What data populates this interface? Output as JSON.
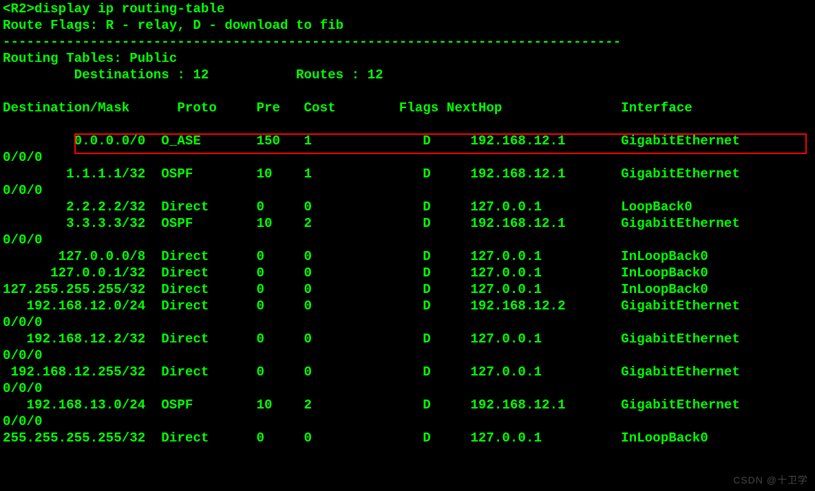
{
  "prompt_prefix": "<R2>",
  "command": "display ip routing-table",
  "flags_line": "Route Flags: R - relay, D - download to fib",
  "dashline": "------------------------------------------------------------------------------",
  "tables_line": "Routing Tables: Public",
  "destinations_label": "Destinations :",
  "destinations_value": "12",
  "routes_label": "Routes :",
  "routes_value": "12",
  "headers": {
    "dest": "Destination/Mask",
    "proto": "Proto",
    "pre": "Pre",
    "cost": "Cost",
    "flags": "Flags",
    "nexthop": "NextHop",
    "interface": "Interface"
  },
  "routes": [
    {
      "dest": "0.0.0.0/0",
      "proto": "O_ASE",
      "pre": "150",
      "cost": "1",
      "flags": "D",
      "nexthop": "192.168.12.1",
      "interface": "GigabitEthernet",
      "wrap": "0/0/0",
      "highlight": true
    },
    {
      "dest": "1.1.1.1/32",
      "proto": "OSPF",
      "pre": "10",
      "cost": "1",
      "flags": "D",
      "nexthop": "192.168.12.1",
      "interface": "GigabitEthernet",
      "wrap": "0/0/0"
    },
    {
      "dest": "2.2.2.2/32",
      "proto": "Direct",
      "pre": "0",
      "cost": "0",
      "flags": "D",
      "nexthop": "127.0.0.1",
      "interface": "LoopBack0"
    },
    {
      "dest": "3.3.3.3/32",
      "proto": "OSPF",
      "pre": "10",
      "cost": "2",
      "flags": "D",
      "nexthop": "192.168.12.1",
      "interface": "GigabitEthernet",
      "wrap": "0/0/0"
    },
    {
      "dest": "127.0.0.0/8",
      "proto": "Direct",
      "pre": "0",
      "cost": "0",
      "flags": "D",
      "nexthop": "127.0.0.1",
      "interface": "InLoopBack0"
    },
    {
      "dest": "127.0.0.1/32",
      "proto": "Direct",
      "pre": "0",
      "cost": "0",
      "flags": "D",
      "nexthop": "127.0.0.1",
      "interface": "InLoopBack0"
    },
    {
      "dest": "127.255.255.255/32",
      "proto": "Direct",
      "pre": "0",
      "cost": "0",
      "flags": "D",
      "nexthop": "127.0.0.1",
      "interface": "InLoopBack0"
    },
    {
      "dest": "192.168.12.0/24",
      "proto": "Direct",
      "pre": "0",
      "cost": "0",
      "flags": "D",
      "nexthop": "192.168.12.2",
      "interface": "GigabitEthernet",
      "wrap": "0/0/0"
    },
    {
      "dest": "192.168.12.2/32",
      "proto": "Direct",
      "pre": "0",
      "cost": "0",
      "flags": "D",
      "nexthop": "127.0.0.1",
      "interface": "GigabitEthernet",
      "wrap": "0/0/0"
    },
    {
      "dest": "192.168.12.255/32",
      "proto": "Direct",
      "pre": "0",
      "cost": "0",
      "flags": "D",
      "nexthop": "127.0.0.1",
      "interface": "GigabitEthernet",
      "wrap": "0/0/0"
    },
    {
      "dest": "192.168.13.0/24",
      "proto": "OSPF",
      "pre": "10",
      "cost": "2",
      "flags": "D",
      "nexthop": "192.168.12.1",
      "interface": "GigabitEthernet",
      "wrap": "0/0/0"
    },
    {
      "dest": "255.255.255.255/32",
      "proto": "Direct",
      "pre": "0",
      "cost": "0",
      "flags": "D",
      "nexthop": "127.0.0.1",
      "interface": "InLoopBack0"
    }
  ],
  "watermark": "CSDN @十卫学",
  "cols": {
    "dest_right": 18,
    "proto": 20,
    "pre": 32,
    "cost": 38,
    "flags": 53,
    "nexthop": 59,
    "interface": 78
  }
}
